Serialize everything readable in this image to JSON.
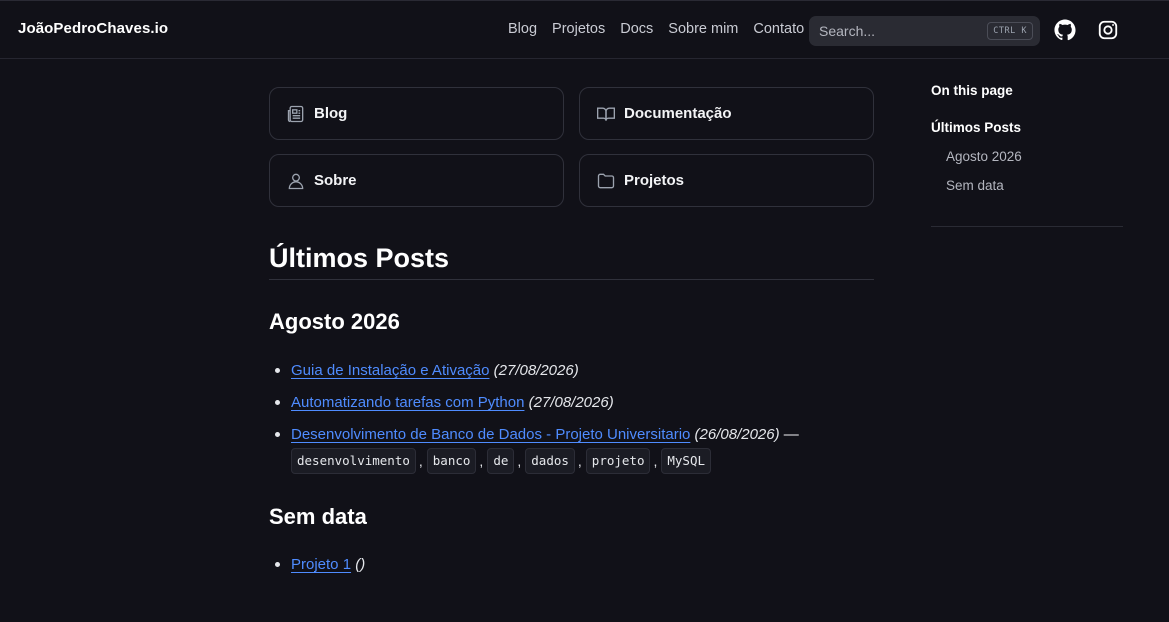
{
  "header": {
    "logo": "JoãoPedroChaves.io",
    "nav": [
      "Blog",
      "Projetos",
      "Docs",
      "Sobre mim",
      "Contato"
    ],
    "search_placeholder": "Search...",
    "search_shortcut": "CTRL K",
    "social": [
      "github-icon",
      "instagram-icon"
    ]
  },
  "cards": [
    {
      "label": "Blog",
      "icon": "newspaper-icon"
    },
    {
      "label": "Documentação",
      "icon": "book-open-icon"
    },
    {
      "label": "Sobre",
      "icon": "user-icon"
    },
    {
      "label": "Projetos",
      "icon": "folder-icon"
    }
  ],
  "content": {
    "title": "Últimos Posts",
    "sections": [
      {
        "heading": "Agosto 2026",
        "posts": [
          {
            "title": "Guia de Instalação e Ativação",
            "date": "(27/08/2026)"
          },
          {
            "title": "Automatizando tarefas com Python",
            "date": "(27/08/2026)"
          },
          {
            "title": "Desenvolvimento de Banco de Dados - Projeto Universitario",
            "date": "(26/08/2026)",
            "dash": "—",
            "tags": [
              "desenvolvimento",
              "banco",
              "de",
              "dados",
              "projeto",
              "MySQL"
            ]
          }
        ]
      },
      {
        "heading": "Sem data",
        "posts": [
          {
            "title": "Projeto 1",
            "date": "()"
          }
        ]
      }
    ]
  },
  "toc": {
    "heading": "On this page",
    "items": [
      "Últimos Posts",
      "Agosto 2026",
      "Sem data"
    ]
  },
  "colors": {
    "background": "#111118",
    "link": "#4f8cff",
    "border": "#30313b"
  }
}
